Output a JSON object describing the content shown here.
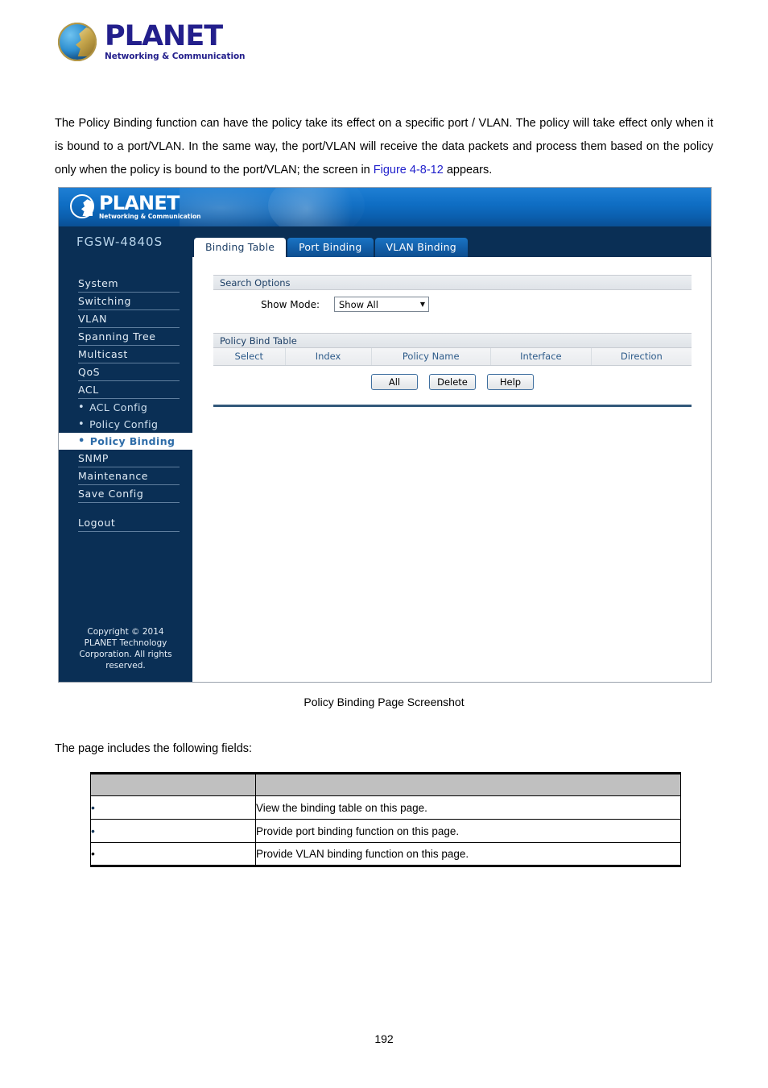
{
  "document": {
    "brand": {
      "name": "PLANET",
      "tagline": "Networking & Communication",
      "logo_icon": "planet-globe-icon"
    },
    "paragraph": {
      "part1": "The Policy Binding function can have the policy take its effect on a specific port / VLAN. The policy will take effect only when it is bound to a port/VLAN. In the same way, the port/VLAN will receive the data packets and process them based on the policy only when the policy is bound to the port/VLAN; the screen in ",
      "figure_link": "Figure 4-8-12",
      "part2": " appears."
    },
    "caption": "Policy Binding Page Screenshot",
    "lead_in": "The page includes the following fields:",
    "page_number": "192"
  },
  "screenshot": {
    "header": {
      "brand": "PLANET",
      "tagline": "Networking & Communication"
    },
    "sidebar": {
      "model": "FGSW-4840S",
      "items": [
        {
          "label": "System",
          "type": "top",
          "active": false
        },
        {
          "label": "Switching",
          "type": "top",
          "active": false
        },
        {
          "label": "VLAN",
          "type": "top",
          "active": false
        },
        {
          "label": "Spanning Tree",
          "type": "top",
          "active": false
        },
        {
          "label": "Multicast",
          "type": "top",
          "active": false
        },
        {
          "label": "QoS",
          "type": "top",
          "active": false
        },
        {
          "label": "ACL",
          "type": "top",
          "active": false
        },
        {
          "label": "ACL Config",
          "type": "sub",
          "active": false
        },
        {
          "label": "Policy Config",
          "type": "sub",
          "active": false
        },
        {
          "label": "Policy Binding",
          "type": "sub",
          "active": true
        },
        {
          "label": "SNMP",
          "type": "top",
          "active": false
        },
        {
          "label": "Maintenance",
          "type": "top",
          "active": false
        },
        {
          "label": "Save Config",
          "type": "top",
          "active": false
        },
        {
          "label": "Logout",
          "type": "top",
          "active": false
        }
      ],
      "bullet": "•",
      "copyright_line1": "Copyright © 2014",
      "copyright_line2": "PLANET Technology",
      "copyright_line3": "Corporation. All rights",
      "copyright_line4": "reserved."
    },
    "tabs": [
      {
        "label": "Binding Table",
        "active": true
      },
      {
        "label": "Port Binding",
        "active": false
      },
      {
        "label": "VLAN Binding",
        "active": false
      }
    ],
    "search_options": {
      "section_title": "Search Options",
      "show_mode_label": "Show Mode:",
      "show_mode_value": "Show All",
      "show_mode_options": [
        "Show All"
      ],
      "caret_icon": "chevron-down-icon"
    },
    "policy_bind_table": {
      "section_title": "Policy Bind Table",
      "columns": [
        "Select",
        "Index",
        "Policy Name",
        "Interface",
        "Direction"
      ],
      "rows": []
    },
    "buttons": [
      {
        "label": "All"
      },
      {
        "label": "Delete"
      },
      {
        "label": "Help"
      }
    ],
    "colors": {
      "header_blue": "#0f6ec4",
      "sidebar_navy": "#0a2f55",
      "active_tab_text": "#1d3f66",
      "active_menu_text": "#2d6ca8",
      "table_header_text": "#2d5b8a",
      "rule_blue": "#32587a"
    }
  },
  "fields_table": {
    "header": [
      "",
      ""
    ],
    "rows": [
      {
        "bullet": "•",
        "object": "",
        "description": "View the binding table on this page."
      },
      {
        "bullet": "•",
        "object": "",
        "description": "Provide port binding function on this page."
      },
      {
        "bullet": "•",
        "object": "",
        "description": "Provide VLAN binding function on this page."
      }
    ]
  }
}
